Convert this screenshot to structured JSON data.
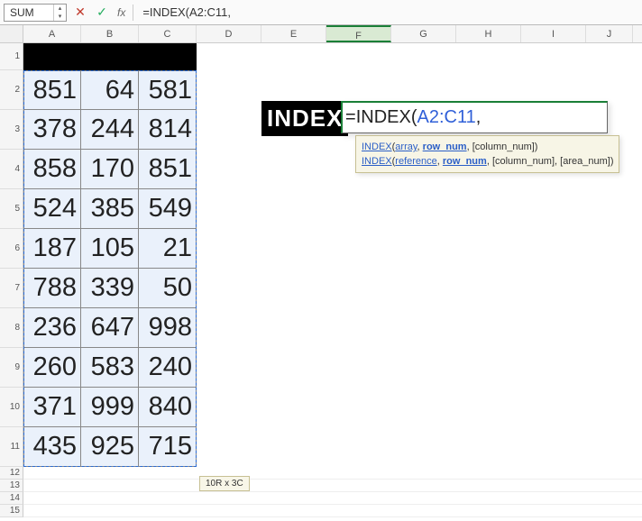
{
  "formula_bar": {
    "name_box": "SUM",
    "cancel_icon": "✕",
    "accept_icon": "✓",
    "fx_label": "fx",
    "formula_text": "=INDEX(A2:C11,"
  },
  "columns": [
    "A",
    "B",
    "C",
    "D",
    "E",
    "F",
    "G",
    "H",
    "I",
    "J"
  ],
  "row_headers": [
    1,
    2,
    3,
    4,
    5,
    6,
    7,
    8,
    9,
    10,
    11,
    12,
    13,
    14,
    15
  ],
  "big_row_height": 44,
  "small_row_height": 14,
  "black_row_height": 30,
  "data": [
    [
      851,
      64,
      581
    ],
    [
      378,
      244,
      814
    ],
    [
      858,
      170,
      851
    ],
    [
      524,
      385,
      549
    ],
    [
      187,
      105,
      21
    ],
    [
      788,
      339,
      50
    ],
    [
      236,
      647,
      998
    ],
    [
      260,
      583,
      240
    ],
    [
      371,
      999,
      840
    ],
    [
      435,
      925,
      715
    ]
  ],
  "selection_tooltip": "10R x 3C",
  "index_label": "INDEX",
  "cell_formula": {
    "eq": "=",
    "fn": "INDEX",
    "open": "(",
    "ref": "A2:C11",
    "comma": ","
  },
  "fn_tooltip": {
    "line1_link": "INDEX",
    "line1_arg1": "array",
    "line1_arg2": "row_num",
    "line1_arg3": "[column_num]",
    "line2_link": "INDEX",
    "line2_arg1": "reference",
    "line2_arg2": "row_num",
    "line2_arg3": "[column_num]",
    "line2_arg4": "[area_num]"
  }
}
